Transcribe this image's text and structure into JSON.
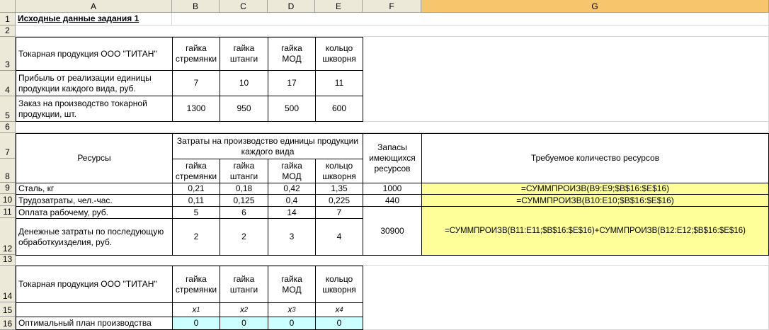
{
  "columns": [
    "A",
    "B",
    "C",
    "D",
    "E",
    "F",
    "G"
  ],
  "rows": [
    "1",
    "2",
    "3",
    "4",
    "5",
    "6",
    "7",
    "8",
    "9",
    "10",
    "11",
    "12",
    "13",
    "14",
    "15",
    "16"
  ],
  "r1": {
    "A": "Исходные данные задания 1"
  },
  "r3": {
    "A": "Токарная продукция ООО \"ТИТАН\"",
    "B": "гайка стремянки",
    "C": "гайка штанги",
    "D": "гайка МОД",
    "E": "кольцо шкворня"
  },
  "r4": {
    "A": "Прибыль от реализации единицы продукции каждого вида, руб.",
    "B": "7",
    "C": "10",
    "D": "17",
    "E": "11"
  },
  "r5": {
    "A": "Заказ на производство токарной продукции, шт.",
    "B": "1300",
    "C": "950",
    "D": "500",
    "E": "600"
  },
  "r7": {
    "A": "Ресурсы",
    "BE": "Затраты на производство единицы продукции каждого вида",
    "F": "Запасы имеющихся ресурсов",
    "G": "Требуемое количество ресурсов"
  },
  "r8": {
    "B": "гайка стремянки",
    "C": "гайка штанги",
    "D": "гайка МОД",
    "E": "кольцо шкворня"
  },
  "r9": {
    "A": "Сталь, кг",
    "B": "0,21",
    "C": "0,18",
    "D": "0,42",
    "E": "1,35",
    "F": "1000",
    "G": "=СУММПРОИЗВ(B9:E9;$B$16:$E$16)"
  },
  "r10": {
    "A": "Трудозатраты, чел.-час.",
    "B": "0,11",
    "C": "0,125",
    "D": "0,4",
    "E": "0,225",
    "F": "440",
    "G": "=СУММПРОИЗВ(B10:E10;$B$16:$E$16)"
  },
  "r11": {
    "A": "Оплата рабочему, руб.",
    "B": "5",
    "C": "6",
    "D": "14",
    "E": "7"
  },
  "r12": {
    "A": "Денежные затраты по последующую обработкуизделия, руб.",
    "B": "2",
    "C": "2",
    "D": "3",
    "E": "4"
  },
  "r1112": {
    "F": "30900",
    "G": "=СУММПРОИЗВ(B11:E11;$B$16:$E$16)+СУММПРОИЗВ(B12:E12;$B$16:$E$16)"
  },
  "r14": {
    "A": "Токарная продукция ООО \"ТИТАН\"",
    "B": "гайка стремянки",
    "C": "гайка штанги",
    "D": "гайка МОД",
    "E": "кольцо шкворня"
  },
  "r15": {
    "B": "x",
    "Bs": "1",
    "C": "x",
    "Cs": "2",
    "D": "x",
    "Ds": "3",
    "E": "x",
    "Es": "4"
  },
  "r16": {
    "A": "Оптимальный план производства",
    "B": "0",
    "C": "0",
    "D": "0",
    "E": "0"
  },
  "colors": {
    "yellow": "#ffff99",
    "cyan": "#ccffff",
    "header": "#ece9d8",
    "selected_header": "#f7c56b"
  }
}
